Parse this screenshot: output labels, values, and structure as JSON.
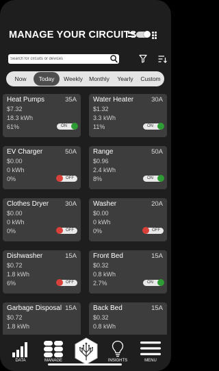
{
  "header": {
    "title": "MANAGE YOUR CIRCUITS"
  },
  "search": {
    "placeholder": "Search for circuits or devices"
  },
  "tabs": [
    "Now",
    "Today",
    "Weekly",
    "Monthly",
    "Yearly",
    "Custom"
  ],
  "active_tab": "Today",
  "circuits": [
    {
      "name": "Heat Pumps",
      "amps": "35A",
      "cost": "$7.32",
      "energy": "18.3 kWh",
      "pct": "61%",
      "state": "ON"
    },
    {
      "name": "Water Heater",
      "amps": "30A",
      "cost": "$1.32",
      "energy": "3.3 kWh",
      "pct": "11%",
      "state": "ON"
    },
    {
      "name": "EV Charger",
      "amps": "50A",
      "cost": "$0.00",
      "energy": "0 kWh",
      "pct": "0%",
      "state": "OFF"
    },
    {
      "name": "Range",
      "amps": "50A",
      "cost": "$0.96",
      "energy": "2.4 kWh",
      "pct": "8%",
      "state": "ON"
    },
    {
      "name": "Clothes Dryer",
      "amps": "30A",
      "cost": "$0.00",
      "energy": "0 kWh",
      "pct": "0%",
      "state": "OFF"
    },
    {
      "name": "Washer",
      "amps": "20A",
      "cost": "$0.00",
      "energy": "0 kWh",
      "pct": "0%",
      "state": "OFF"
    },
    {
      "name": "Dishwasher",
      "amps": "15A",
      "cost": "$0.72",
      "energy": "1.8 kWh",
      "pct": "6%",
      "state": "OFF"
    },
    {
      "name": "Front Bed",
      "amps": "15A",
      "cost": "$0.32",
      "energy": "0.8 kWh",
      "pct": "2.7%",
      "state": "ON"
    },
    {
      "name": "Garbage Disposal",
      "amps": "15A",
      "cost": "$0.72",
      "energy": "1.8 kWh",
      "pct": "",
      "state": ""
    },
    {
      "name": "Back Bed",
      "amps": "15A",
      "cost": "$0.32",
      "energy": "0.8 kWh",
      "pct": "",
      "state": ""
    }
  ],
  "nav": [
    {
      "label": "DATA",
      "icon": "bar-chart-icon"
    },
    {
      "label": "MANAGE",
      "icon": "grid-icon"
    },
    {
      "label": "",
      "icon": "circuit-tree-logo-icon"
    },
    {
      "label": "INSIGHTS",
      "icon": "lightbulb-icon"
    },
    {
      "label": "MENU",
      "icon": "hamburger-icon"
    }
  ],
  "colors": {
    "on": "#2e9c35",
    "off": "#d9403a",
    "card": "#3d3d3d",
    "background": "#1e1e1e"
  }
}
